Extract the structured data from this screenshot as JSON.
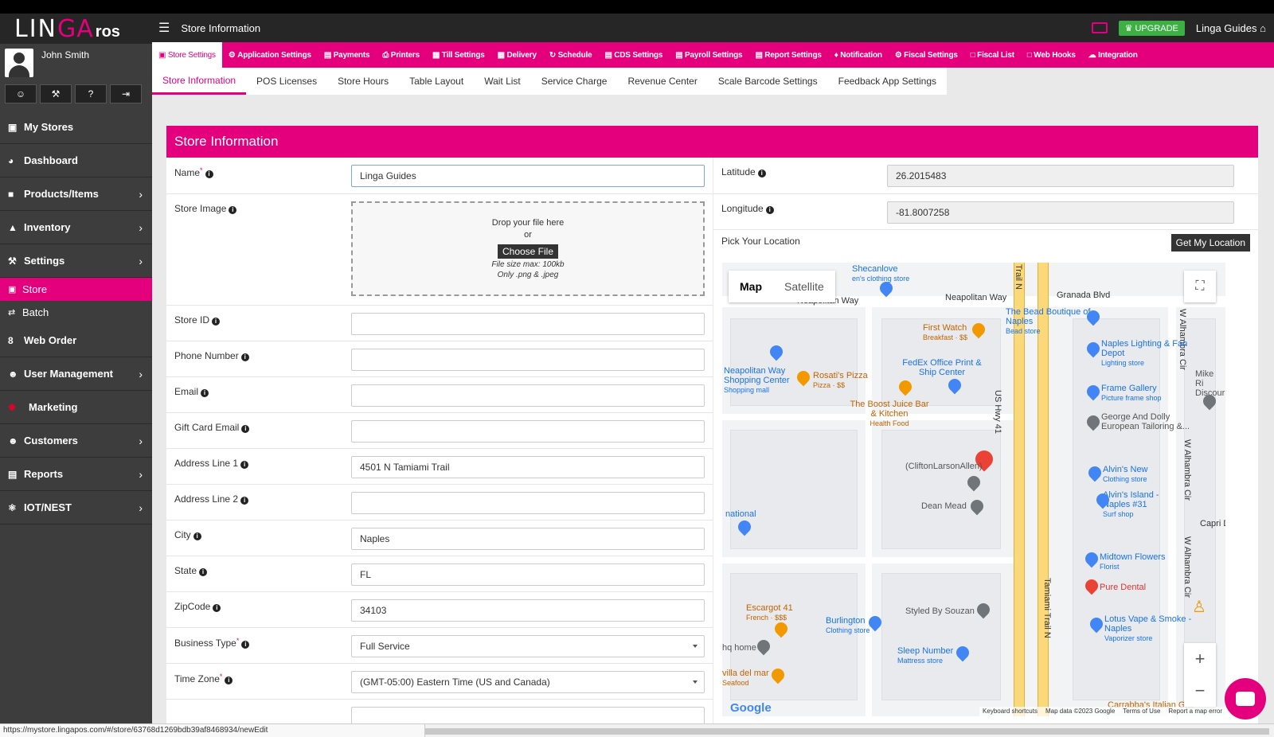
{
  "app": {
    "logo_part1": "LIN",
    "logo_part2": "GA",
    "logo_part3": "ros",
    "user_name": "John Smith",
    "header_title": "Store Information",
    "upgrade_label": "UPGRADE",
    "store_name": "Linga Guides",
    "status_url": "https://mystore.lingapos.com/#/store/63768d1269bdb39af8468934/newEdit"
  },
  "colors": {
    "brand_pink": "#e4007c",
    "sidebar_bg": "#3d3d3d",
    "header_bg": "#262626",
    "upgrade_green": "#3cb043"
  },
  "sidebar": {
    "quick_icons": [
      "user-icon",
      "wrench-icon",
      "help-icon",
      "logout-icon"
    ],
    "items": [
      {
        "label": "My Stores",
        "icon": "store-icon",
        "chev": ""
      },
      {
        "label": "Dashboard",
        "icon": "dashboard-icon",
        "chev": ""
      },
      {
        "label": "Products/Items",
        "icon": "gift-icon",
        "chev": "›"
      },
      {
        "label": "Inventory",
        "icon": "inventory-icon",
        "chev": "›"
      },
      {
        "label": "Settings",
        "icon": "wrench-icon",
        "chev": "›"
      }
    ],
    "subitems": [
      {
        "label": "Store",
        "icon": "store-icon"
      },
      {
        "label": "Batch",
        "icon": "exchange-icon"
      }
    ],
    "items2": [
      {
        "label": "Web Order",
        "icon": "web-order-icon",
        "chev": ""
      },
      {
        "label": "User Management",
        "icon": "users-icon",
        "chev": "›"
      },
      {
        "label": "Marketing",
        "icon": "new-badge-icon",
        "chev": ""
      },
      {
        "label": "Customers",
        "icon": "users-icon",
        "chev": "›"
      },
      {
        "label": "Reports",
        "icon": "reports-icon",
        "chev": "›"
      },
      {
        "label": "IOT/NEST",
        "icon": "plug-icon",
        "chev": "›"
      }
    ]
  },
  "settings_menu": [
    "Store Settings",
    "Application Settings",
    "Payments",
    "Printers",
    "Till Settings",
    "Delivery",
    "Schedule",
    "CDS Settings",
    "Payroll Settings",
    "Report Settings",
    "Notification",
    "Fiscal Settings",
    "Fiscal List",
    "Web Hooks",
    "Integration"
  ],
  "sub_tabs": [
    "Store Information",
    "POS Licenses",
    "Store Hours",
    "Table Layout",
    "Wait List",
    "Service Charge",
    "Revenue Center",
    "Scale Barcode Settings",
    "Feedback App Settings"
  ],
  "panel": {
    "title": "Store Information",
    "name": {
      "label": "Name",
      "value": "Linga Guides"
    },
    "store_image": {
      "label": "Store Image",
      "drop_text": "Drop your file here",
      "or_text": "or",
      "choose_label": "Choose File",
      "size_hint": "File size max: 100kb",
      "type_hint": "Only .png & .jpeg"
    },
    "store_id": {
      "label": "Store ID",
      "value": ""
    },
    "phone": {
      "label": "Phone Number",
      "value": ""
    },
    "email": {
      "label": "Email",
      "value": ""
    },
    "gift_email": {
      "label": "Gift Card Email",
      "value": ""
    },
    "address1": {
      "label": "Address Line 1",
      "value": "4501 N Tamiami Trail"
    },
    "address2": {
      "label": "Address Line 2",
      "value": ""
    },
    "city": {
      "label": "City",
      "value": "Naples"
    },
    "state": {
      "label": "State",
      "value": "FL"
    },
    "zip": {
      "label": "ZipCode",
      "value": "34103"
    },
    "business_type": {
      "label": "Business Type",
      "value": "Full Service"
    },
    "timezone": {
      "label": "Time Zone",
      "value": "(GMT-05:00) Eastern Time (US and Canada)"
    },
    "latitude": {
      "label": "Latitude",
      "value": "26.2015483"
    },
    "longitude": {
      "label": "Longitude",
      "value": "-81.8007258"
    },
    "pick_location": "Pick Your Location",
    "get_location_label": "Get My Location"
  },
  "map": {
    "type_map": "Map",
    "type_satellite": "Satellite",
    "roads": {
      "neapolitan1": "Neapolitan Way",
      "neapolitan2": "Neapolitan Way",
      "granada": "Granada Blvd",
      "usHwy": "US Hwy 41",
      "tamiami": "Tamiami Trail N",
      "trailN": "Trail N",
      "walhambra1": "W Alhambra Cir",
      "walhambra2": "W Alhambra Cir",
      "walhambra3": "W Alhambra Cir",
      "capri": "Capri Dr"
    },
    "pois": {
      "shecanlove": "Shecanlove",
      "shecanlove_sub": "en's clothing store",
      "bead": "The Bead Boutique of Naples",
      "bead_sub": "Bead store",
      "firstwatch": "First Watch",
      "firstwatch_sub": "Breakfast · $$",
      "naplesLighting": "Naples Lighting & Fan Depot",
      "naplesLighting_sub": "Lighting store",
      "fedex": "FedEx Office Print & Ship Center",
      "npway": "Neapolitan Way Shopping Center",
      "npway_sub": "Shopping mall",
      "rosati": "Rosati's Pizza",
      "rosati_sub": "Pizza · $$",
      "frame": "Frame Gallery",
      "frame_sub": "Picture frame shop",
      "mike": "Mike Ri Discour",
      "boost": "The Boost Juice Bar & Kitchen",
      "boost_sub": "Health Food",
      "george": "George And Dolly European Tailoring &...",
      "clifton": "(CliftonLarsonAllen)",
      "alvinsNew": "Alvin's New",
      "alvinsNew_sub": "Clothing store",
      "alvinsIsland": "Alvin's Island - Naples #31",
      "alvinsIsland_sub": "Surf shop",
      "deanMead": "Dean Mead",
      "national": "national",
      "midtown": "Midtown Flowers",
      "midtown_sub": "Florist",
      "pureDental": "Pure Dental",
      "escargot": "Escargot 41",
      "escargot_sub": "French · $$$",
      "burlington": "Burlington",
      "burlington_sub": "Clothing store",
      "styled": "Styled By Souzan",
      "lotus": "Lotus Vape & Smoke - Naples",
      "lotus_sub": "Vaporizer store",
      "hqhome": "hq home",
      "sleep": "Sleep Number",
      "sleep_sub": "Mattress store",
      "villa": "villa del mar",
      "villa_sub": "Seafood",
      "carrabba": "Carrabba's Italian Grill"
    },
    "footer": [
      "Keyboard shortcuts",
      "Map data ©2023 Google",
      "Terms of Use",
      "Report a map error"
    ],
    "google": "Google"
  }
}
